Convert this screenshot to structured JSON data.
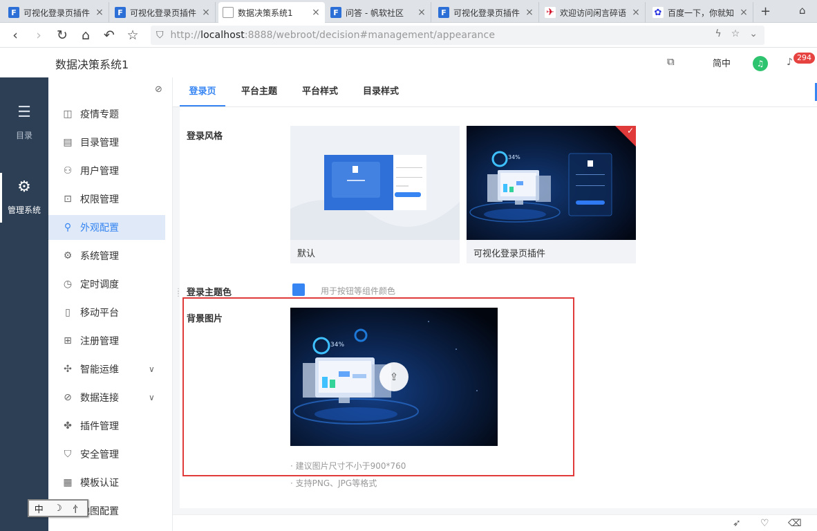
{
  "browser": {
    "tabs": [
      {
        "title": "可视化登录页插件",
        "favicon": "fanruan-logo-icon",
        "active": false
      },
      {
        "title": "可视化登录页插件",
        "favicon": "fanruan-logo-icon",
        "active": false
      },
      {
        "title": "数据决策系统1",
        "favicon": "page-icon",
        "active": true
      },
      {
        "title": "问答 - 帆软社区",
        "favicon": "fanruan-logo-icon",
        "active": false
      },
      {
        "title": "可视化登录页插件",
        "favicon": "fanruan-logo-icon",
        "active": false
      },
      {
        "title": "欢迎访问闲言碎语",
        "favicon": "red-logo-icon",
        "active": false
      },
      {
        "title": "百度一下，你就知",
        "favicon": "baidu-paw-icon",
        "active": false
      }
    ],
    "url_host": "localhost",
    "url_rest": ":8888/webroot/decision#management/appearance",
    "url_prefix": "http://"
  },
  "header": {
    "title": "数据决策系统1",
    "lang": "简中",
    "notification_count": "294"
  },
  "rail": {
    "items": [
      {
        "label": "目录",
        "icon": "list-icon",
        "active": false
      },
      {
        "label": "管理系统",
        "icon": "gear-icon",
        "active": true
      }
    ]
  },
  "menu": {
    "items": [
      {
        "label": "疫情专题",
        "icon": "dashboard-icon"
      },
      {
        "label": "目录管理",
        "icon": "catalog-icon"
      },
      {
        "label": "用户管理",
        "icon": "user-icon"
      },
      {
        "label": "权限管理",
        "icon": "lock-icon"
      },
      {
        "label": "外观配置",
        "icon": "brush-icon",
        "active": true
      },
      {
        "label": "系统管理",
        "icon": "settings-icon"
      },
      {
        "label": "定时调度",
        "icon": "timer-icon"
      },
      {
        "label": "移动平台",
        "icon": "mobile-icon"
      },
      {
        "label": "注册管理",
        "icon": "register-icon"
      },
      {
        "label": "智能运维",
        "icon": "ops-icon",
        "expandable": true
      },
      {
        "label": "数据连接",
        "icon": "link-icon",
        "expandable": true
      },
      {
        "label": "插件管理",
        "icon": "plugin-icon"
      },
      {
        "label": "安全管理",
        "icon": "shield-icon"
      },
      {
        "label": "模板认证",
        "icon": "certificate-icon"
      },
      {
        "label": "地图配置",
        "icon": "map-icon"
      }
    ]
  },
  "page_tabs": [
    {
      "label": "登录页",
      "active": true
    },
    {
      "label": "平台主题",
      "active": false
    },
    {
      "label": "平台样式",
      "active": false
    },
    {
      "label": "目录样式",
      "active": false
    }
  ],
  "login": {
    "style_label": "登录风格",
    "styles": [
      {
        "caption": "默认",
        "selected": false
      },
      {
        "caption": "可视化登录页插件",
        "selected": true
      }
    ],
    "theme_color_label": "登录主题色",
    "theme_color": "#3685f2",
    "theme_color_desc": "用于按钮等组件颜色",
    "bg_label": "背景图片",
    "bg_tips": [
      "· 建议图片尺寸不小于900*760",
      "· 支持PNG、JPG等格式"
    ],
    "thumb_percent": "34%"
  },
  "langwidget": {
    "chars": [
      "中",
      "☽",
      "⺖"
    ]
  },
  "colors": {
    "accent": "#3685f2",
    "rail": "#2c3f55",
    "highlight": "#e03a3a"
  }
}
